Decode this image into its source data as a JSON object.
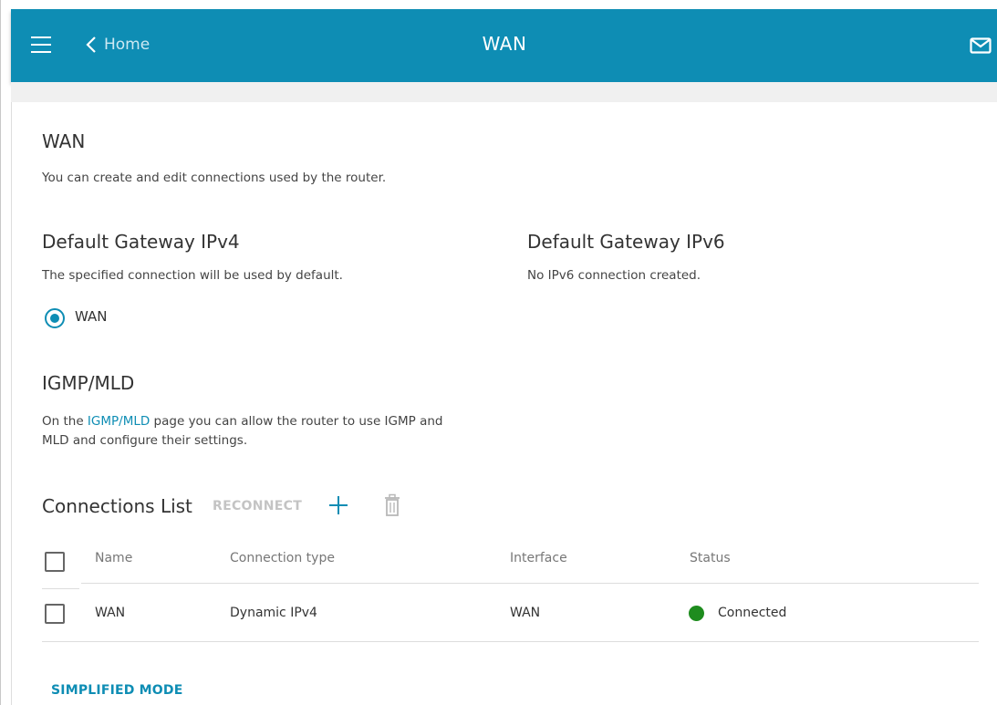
{
  "header": {
    "back_label": "Home",
    "title": "WAN",
    "icons": {
      "menu": "hamburger-icon",
      "back": "chevron-left-icon",
      "mail": "mail-icon"
    }
  },
  "section": {
    "title": "WAN",
    "description": "You can create and edit connections used by the router."
  },
  "gateway_ipv4": {
    "title": "Default Gateway IPv4",
    "description": "The specified connection will be used by default.",
    "option_label": "WAN",
    "selected": true
  },
  "gateway_ipv6": {
    "title": "Default Gateway IPv6",
    "description": "No IPv6 connection created."
  },
  "igmp": {
    "title": "IGMP/MLD",
    "text_before": "On the ",
    "link_label": "IGMP/MLD",
    "text_after_line1": " page you can allow the router to use IGMP and",
    "text_line2": "MLD and configure their settings."
  },
  "connections": {
    "title": "Connections List",
    "reconnect_label": "RECONNECT",
    "columns": [
      "Name",
      "Connection type",
      "Interface",
      "Status"
    ],
    "rows": [
      {
        "name": "WAN",
        "type": "Dynamic IPv4",
        "interface": "WAN",
        "status": "Connected"
      }
    ]
  },
  "footer": {
    "simplified_label": "SIMPLIFIED MODE"
  },
  "colors": {
    "accent": "#0e8db4",
    "status_connected": "#1e8c1e"
  }
}
